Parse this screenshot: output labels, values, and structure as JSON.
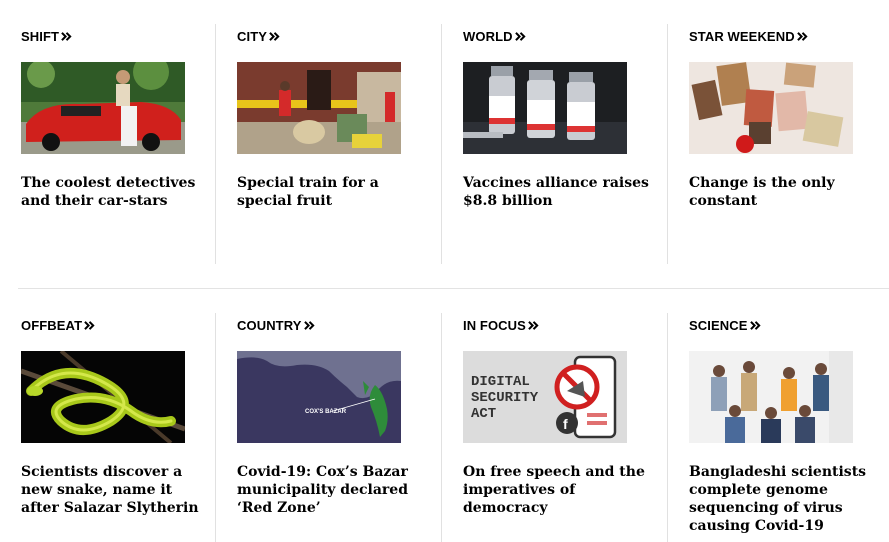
{
  "rows": [
    {
      "items": [
        {
          "section": "SHIFT",
          "headline": "The coolest detectives and their car-stars",
          "image": "car-photo"
        },
        {
          "section": "CITY",
          "headline": "Special train for a special fruit",
          "image": "train-mango-photo"
        },
        {
          "section": "WORLD",
          "headline": "Vaccines alliance raises $8.8 billion",
          "image": "vaccine-vials-photo"
        },
        {
          "section": "STAR WEEKEND",
          "headline": "Change is the only constant",
          "image": "magazines-photo"
        }
      ]
    },
    {
      "items": [
        {
          "section": "OFFBEAT",
          "headline": "Scientists discover a new snake, name it after Salazar Slytherin",
          "image": "green-snake-photo"
        },
        {
          "section": "COUNTRY",
          "headline": "Covid-19: Cox’s Bazar municipality declared ‘Red Zone’",
          "image": "map-graphic",
          "map_label": "COX'S BAZAR"
        },
        {
          "section": "IN FOCUS",
          "headline": "On free speech and the imperatives of democracy",
          "image": "digital-security-graphic",
          "graphic_text": [
            "DIGITAL",
            "SECURITY",
            "ACT"
          ]
        },
        {
          "section": "SCIENCE",
          "headline": "Bangladeshi scientists complete genome sequencing of virus causing Covid-19",
          "image": "scientists-group-photo"
        }
      ]
    }
  ],
  "icons": {
    "section_arrow": "double-chevron-right-icon"
  }
}
